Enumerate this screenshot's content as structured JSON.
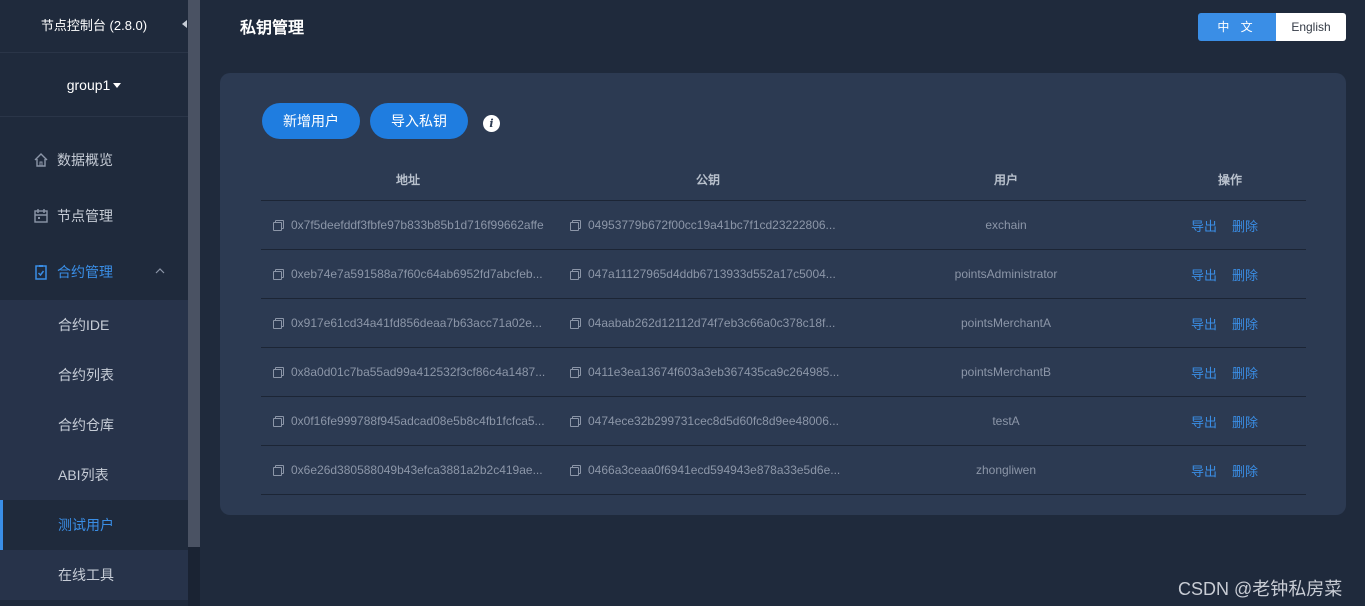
{
  "sidebar": {
    "title": "节点控制台 (2.8.0)",
    "group": "group1",
    "menu": [
      {
        "label": "数据概览",
        "icon": "home-icon"
      },
      {
        "label": "节点管理",
        "icon": "calendar-icon"
      },
      {
        "label": "合约管理",
        "icon": "clipboard-icon"
      }
    ],
    "submenu": [
      {
        "label": "合约IDE"
      },
      {
        "label": "合约列表"
      },
      {
        "label": "合约仓库"
      },
      {
        "label": "ABI列表"
      },
      {
        "label": "测试用户"
      },
      {
        "label": "在线工具"
      }
    ]
  },
  "header": {
    "title": "私钥管理",
    "lang_zh": "中 文",
    "lang_en": "English"
  },
  "toolbar": {
    "add_user": "新增用户",
    "import_key": "导入私钥",
    "info": "i"
  },
  "table": {
    "columns": [
      "地址",
      "公钥",
      "用户",
      "操作"
    ],
    "rows": [
      {
        "address": "0x7f5deefddf3fbfe97b833b85b1d716f99662affe",
        "pubkey": "04953779b672f00cc19a41bc7f1cd23222806...",
        "user": "exchain"
      },
      {
        "address": "0xeb74e7a591588a7f60c64ab6952fd7abcfeb...",
        "pubkey": "047a11127965d4ddb6713933d552a17c5004...",
        "user": "pointsAdministrator"
      },
      {
        "address": "0x917e61cd34a41fd856deaa7b63acc71a02e...",
        "pubkey": "04aabab262d12112d74f7eb3c66a0c378c18f...",
        "user": "pointsMerchantA"
      },
      {
        "address": "0x8a0d01c7ba55ad99a412532f3cf86c4a1487...",
        "pubkey": "0411e3ea13674f603a3eb367435ca9c264985...",
        "user": "pointsMerchantB"
      },
      {
        "address": "0x0f16fe999788f945adcad08e5b8c4fb1fcfca5...",
        "pubkey": "0474ece32b299731cec8d5d60fc8d9ee48006...",
        "user": "testA"
      },
      {
        "address": "0x6e26d380588049b43efca3881a2b2c419ae...",
        "pubkey": "0466a3ceaa0f6941ecd594943e878a33e5d6e...",
        "user": "zhongliwen"
      }
    ],
    "op_export": "导出",
    "op_delete": "删除"
  },
  "watermark": "CSDN @老钟私房菜"
}
